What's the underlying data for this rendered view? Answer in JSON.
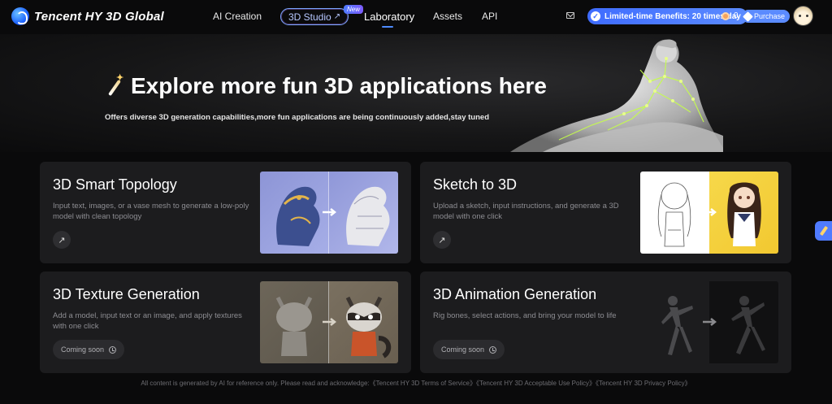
{
  "nav": {
    "brand": "Tencent HY 3D Global",
    "items": [
      "AI Creation",
      "3D Studio",
      "Laboratory",
      "Assets",
      "API"
    ],
    "studio_badge": "New",
    "active": "Laboratory",
    "benefits": "Limited-time Benefits: 20 times/day",
    "coins": "0",
    "purchase": "Purchase"
  },
  "hero": {
    "title": "Explore more fun 3D applications here",
    "subtitle": "Offers diverse 3D generation capabilities,more fun applications are being continuously added,stay tuned"
  },
  "cards": [
    {
      "title": "3D Smart Topology",
      "desc": "Input text, images, or a vase mesh to generate a low-poly model with clean topology",
      "action": "arrow"
    },
    {
      "title": "Sketch to 3D",
      "desc": "Upload a sketch, input instructions, and generate a 3D model with one click",
      "action": "arrow"
    },
    {
      "title": "3D Texture Generation",
      "desc": "Add a model, input text or an image, and apply textures with one click",
      "action": "Coming soon"
    },
    {
      "title": "3D Animation Generation",
      "desc": "Rig bones, select actions, and bring your model to life",
      "action": "Coming soon"
    }
  ],
  "footer": "All content is generated by AI for reference only. Please read and acknowledge:《Tencent HY 3D Terms of Service》《Tencent HY 3D Acceptable Use Policy》《Tencent HY 3D Privacy Policy》",
  "colors": {
    "accent": "#4d8bff",
    "card_bg": "#1c1c1e",
    "page_bg": "#0a0a0b"
  }
}
